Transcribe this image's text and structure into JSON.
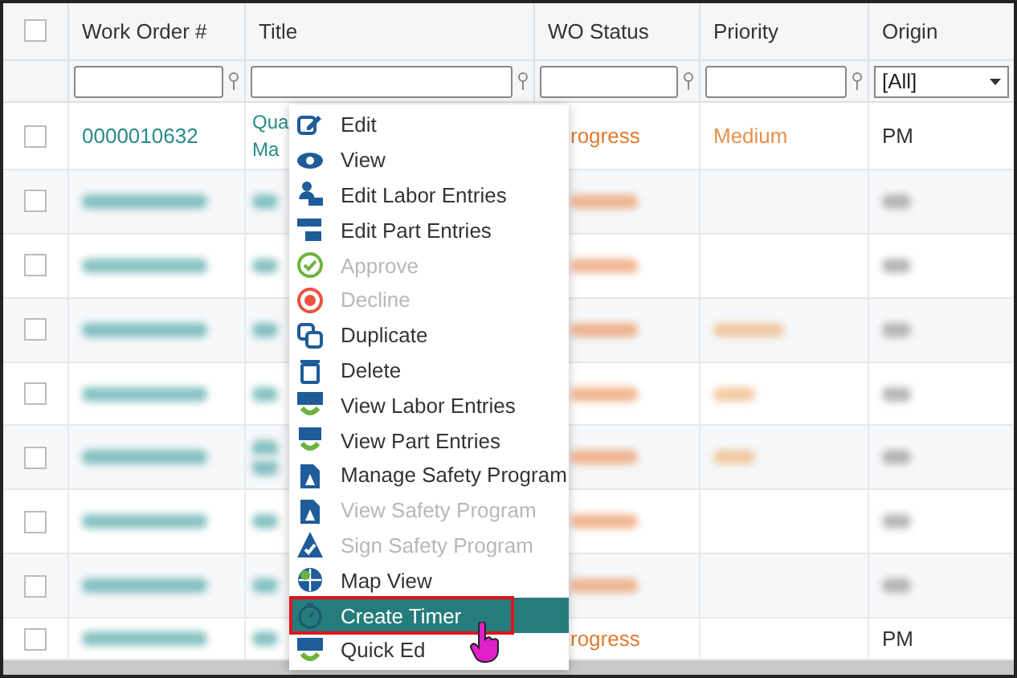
{
  "table": {
    "select_all": {
      "checked": false
    },
    "columns": [
      "Work Order #",
      "Title",
      "WO Status",
      "Priority",
      "Origin"
    ],
    "filters": [
      {
        "kind": "text"
      },
      {
        "kind": "text"
      },
      {
        "kind": "text"
      },
      {
        "kind": "text"
      },
      {
        "kind": "select",
        "value": "[All]"
      }
    ],
    "rows": [
      {
        "checked": false,
        "blurred": false,
        "work_order": "0000010632",
        "title": [
          "Qua",
          "Ma"
        ],
        "status": "rogress",
        "priority": "Medium",
        "origin": "PM"
      },
      {
        "checked": false,
        "blurred": true,
        "priority_shown": false,
        "two_line_title": false
      },
      {
        "checked": false,
        "blurred": true,
        "priority_shown": false,
        "two_line_title": false
      },
      {
        "checked": false,
        "blurred": true,
        "priority_shown": true,
        "two_line_title": false
      },
      {
        "checked": false,
        "blurred": true,
        "priority_shown": true,
        "two_line_title": false
      },
      {
        "checked": false,
        "blurred": true,
        "priority_shown": true,
        "two_line_title": true
      },
      {
        "checked": false,
        "blurred": true,
        "priority_shown": false,
        "two_line_title": false
      },
      {
        "checked": false,
        "blurred": true,
        "priority_shown": false,
        "two_line_title": false
      },
      {
        "checked": false,
        "blurred": true,
        "priority_shown": false,
        "two_line_title": false,
        "status": "rogress",
        "origin": "PM"
      }
    ]
  },
  "context_menu": {
    "items": [
      {
        "label": "Edit",
        "disabled": false,
        "selected": false
      },
      {
        "label": "View",
        "disabled": false,
        "selected": false
      },
      {
        "label": "Edit Labor Entries",
        "disabled": false,
        "selected": false
      },
      {
        "label": "Edit Part Entries",
        "disabled": false,
        "selected": false
      },
      {
        "label": "Approve",
        "disabled": true,
        "selected": false
      },
      {
        "label": "Decline",
        "disabled": true,
        "selected": false
      },
      {
        "label": "Duplicate",
        "disabled": false,
        "selected": false
      },
      {
        "label": "Delete",
        "disabled": false,
        "selected": false
      },
      {
        "label": "View Labor Entries",
        "disabled": false,
        "selected": false
      },
      {
        "label": "View Part Entries",
        "disabled": false,
        "selected": false
      },
      {
        "label": "Manage Safety Program",
        "disabled": false,
        "selected": false
      },
      {
        "label": "View Safety Program",
        "disabled": true,
        "selected": false
      },
      {
        "label": "Sign Safety Program",
        "disabled": true,
        "selected": false
      },
      {
        "label": "Map View",
        "disabled": false,
        "selected": false
      },
      {
        "label": "Create Timer",
        "disabled": false,
        "selected": true
      },
      {
        "label": "Quick Ed",
        "disabled": false,
        "selected": false
      }
    ]
  }
}
